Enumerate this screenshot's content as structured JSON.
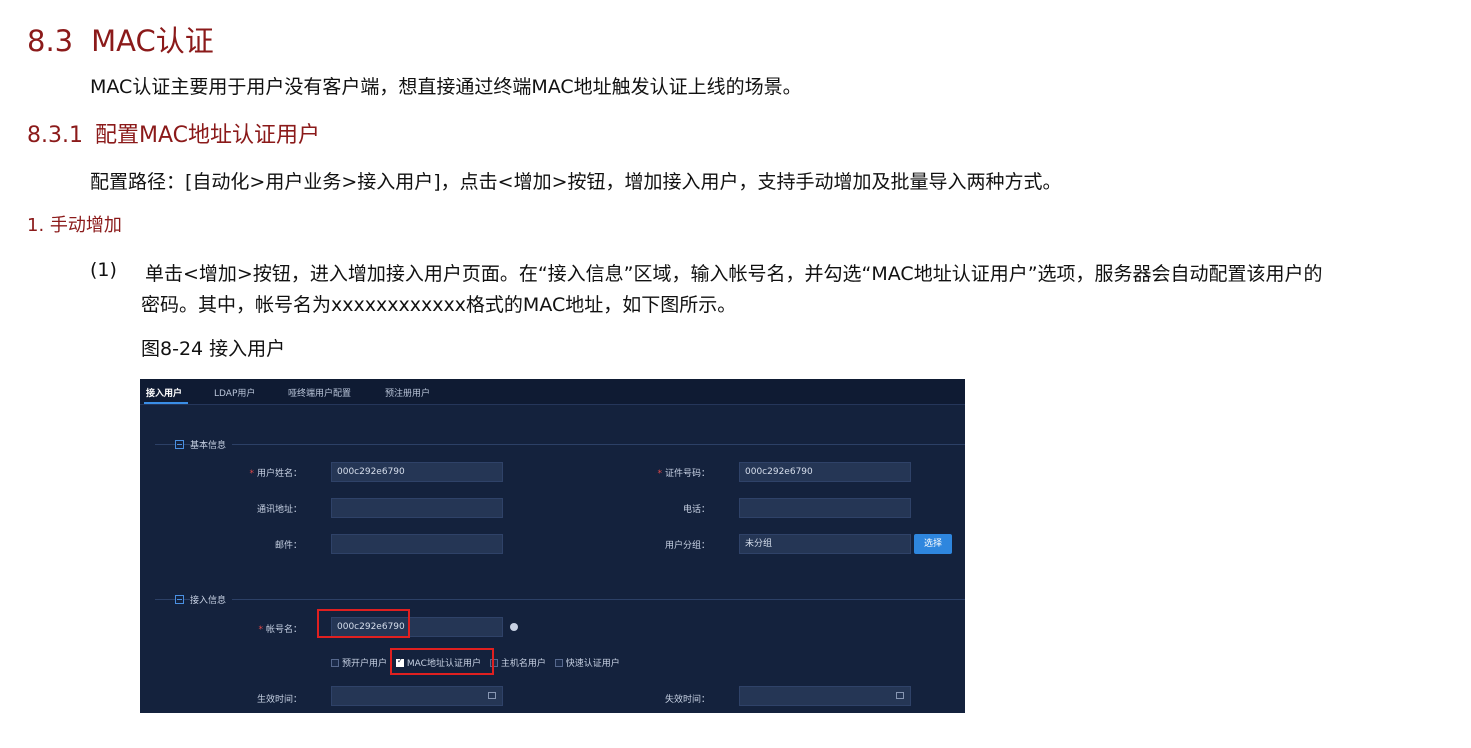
{
  "section": {
    "number": "8.3",
    "title": "MAC认证"
  },
  "intro": "MAC认证主要用于用户没有客户端，想直接通过终端MAC地址触发认证上线的场景。",
  "subsection": {
    "number": "8.3.1",
    "title": "配置MAC地址认证用户"
  },
  "config_path": "配置路径：[自动化>用户业务>接入用户]，点击<增加>按钮，增加接入用户，支持手动增加及批量导入两种方式。",
  "method_heading": "1. 手动增加",
  "step": {
    "index": "(1)",
    "line1": "单击<增加>按钮，进入增加接入用户页面。在“接入信息”区域，输入帐号名，并勾选“MAC地址认证用户”选项，服务器会自动配置该用户的",
    "line2": "密码。其中，帐号名为xxxxxxxxxxxx格式的MAC地址，如下图所示。"
  },
  "figure_caption": "图8-24 接入用户",
  "screenshot": {
    "tabs": [
      "接入用户",
      "LDAP用户",
      "哑终端用户配置",
      "预注册用户"
    ],
    "basic_section": "基本信息",
    "fields": {
      "user_name_label": "用户姓名：",
      "user_name_value": "000c292e6790",
      "id_number_label": "证件号码：",
      "id_number_value": "000c292e6790",
      "address_label": "通讯地址：",
      "phone_label": "电话：",
      "email_label": "邮件：",
      "group_label": "用户分组：",
      "group_value": "未分组",
      "select_button": "选择"
    },
    "access_section": "接入信息",
    "account_label": "帐号名：",
    "account_value": "000c292e6790",
    "checkboxes": [
      {
        "label": "预开户用户",
        "checked": false
      },
      {
        "label": "MAC地址认证用户",
        "checked": true
      },
      {
        "label": "主机名用户",
        "checked": false
      },
      {
        "label": "快速认证用户",
        "checked": false
      }
    ],
    "effective_time_label": "生效时间：",
    "expire_time_label": "失效时间："
  }
}
